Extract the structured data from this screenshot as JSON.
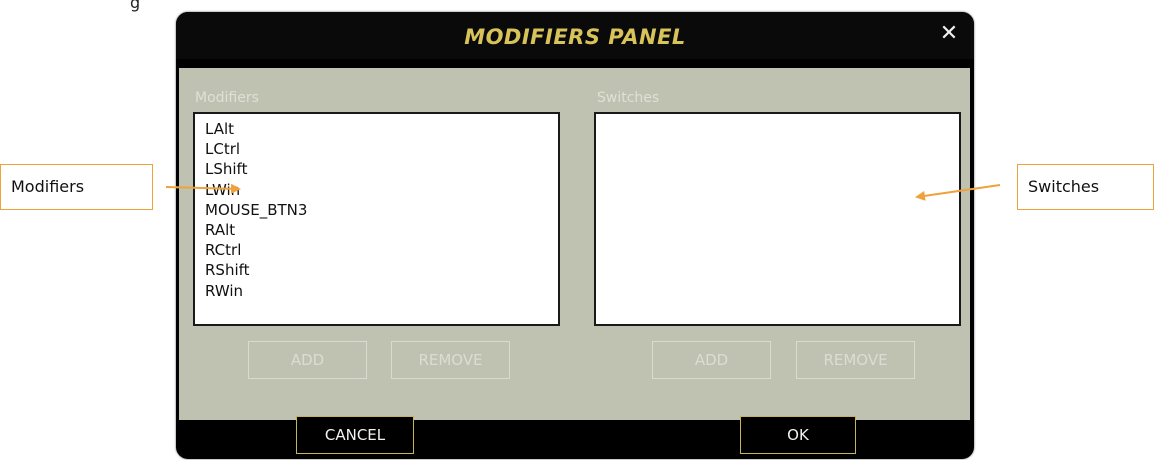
{
  "header_fragment": "g",
  "dialog": {
    "title": "MODIFIERS PANEL",
    "close_glyph": "✕"
  },
  "modifiers": {
    "label": "Modifiers",
    "items": [
      "LAlt",
      "LCtrl",
      "LShift",
      "LWin",
      "MOUSE_BTN3",
      "RAlt",
      "RCtrl",
      "RShift",
      "RWin"
    ],
    "add_label": "ADD",
    "remove_label": "REMOVE"
  },
  "switches": {
    "label": "Switches",
    "items": [],
    "add_label": "ADD",
    "remove_label": "REMOVE"
  },
  "footer": {
    "cancel_label": "CANCEL",
    "ok_label": "OK"
  },
  "callouts": {
    "modifiers": "Modifiers",
    "switches": "Switches"
  },
  "colors": {
    "title": "#d8c25a",
    "panel_bg": "#bfc2b0",
    "callout_border": "#f0a23a",
    "button_border_footer": "#c8b45a"
  }
}
